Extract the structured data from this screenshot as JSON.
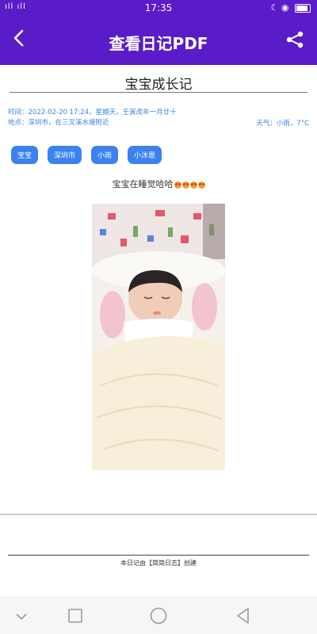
{
  "status_bar": {
    "signal": "ıll ıll",
    "time": "17:35",
    "icons": [
      "wifi-icon",
      "moon-icon",
      "location-icon",
      "battery-icon"
    ]
  },
  "header": {
    "title": "查看日记PDF",
    "back_icon": "back-arrow-icon",
    "share_icon": "share-icon",
    "background": "#5a1cc8"
  },
  "document": {
    "title": "宝宝成长记",
    "time_line": "时间：2022-02-20 17:24，星期天，壬寅虎年一月廿十",
    "location_line": "地点：深圳市，在三叉溪水塘附近",
    "weather": "天气：小雨，7°C",
    "tags": [
      "宝宝",
      "深圳市",
      "小雨",
      "小沐恩"
    ],
    "caption": "宝宝在睡觉哈哈",
    "caption_emoji_count": 4,
    "footer": "本日记由【简简日志】创建"
  },
  "nav_bar": {
    "buttons": [
      "chevron-down-icon",
      "square-icon",
      "circle-icon",
      "triangle-back-icon"
    ]
  }
}
